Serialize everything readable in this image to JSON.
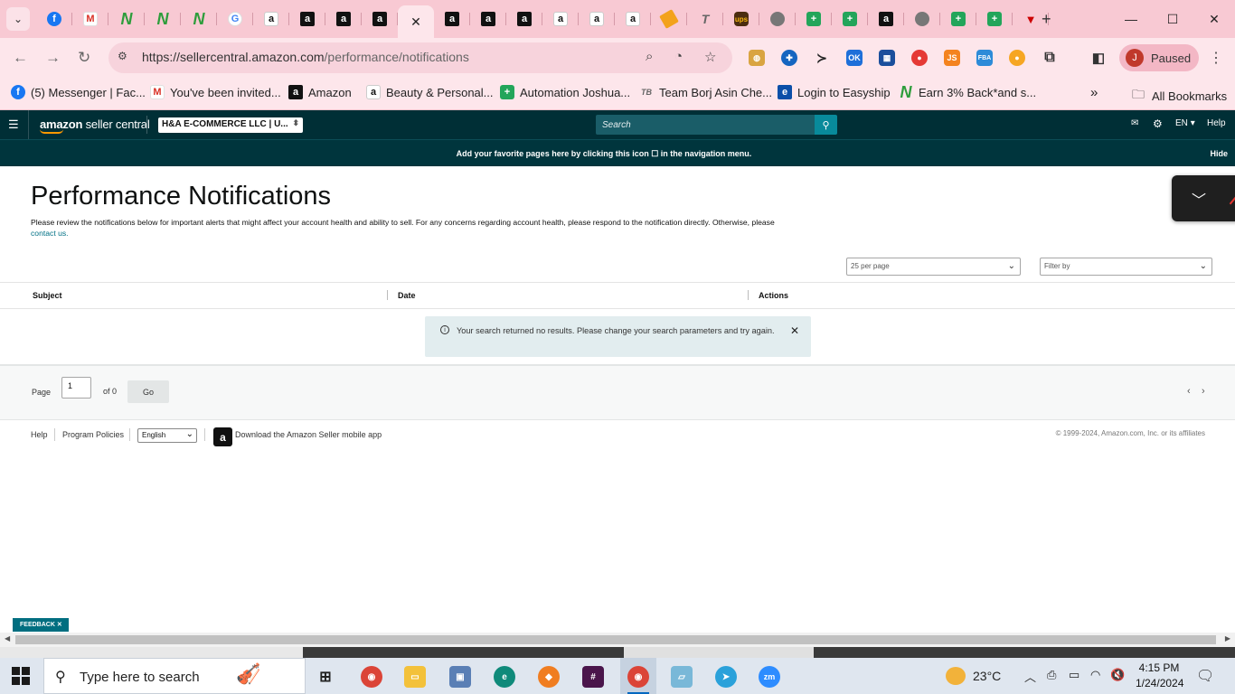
{
  "browser": {
    "tabs": [
      {
        "icon": "facebook-icon",
        "kind": "fb",
        "glyph": "f"
      },
      {
        "icon": "gmail-icon",
        "kind": "gm",
        "glyph": "M"
      },
      {
        "icon": "n-logo-icon",
        "kind": "n",
        "glyph": "N"
      },
      {
        "icon": "n-logo-icon",
        "kind": "n",
        "glyph": "N"
      },
      {
        "icon": "n-logo-icon",
        "kind": "n",
        "glyph": "N"
      },
      {
        "icon": "google-icon",
        "kind": "g",
        "glyph": "G"
      },
      {
        "icon": "amazon-icon",
        "kind": "ay",
        "glyph": "a"
      },
      {
        "icon": "amazon-icon",
        "kind": "a",
        "glyph": "a"
      },
      {
        "icon": "amazon-icon",
        "kind": "a",
        "glyph": "a"
      },
      {
        "icon": "amazon-icon",
        "kind": "a",
        "glyph": "a"
      },
      {
        "icon": "close-icon",
        "kind": "active",
        "glyph": "✕"
      },
      {
        "icon": "amazon-icon",
        "kind": "a",
        "glyph": "a"
      },
      {
        "icon": "amazon-icon",
        "kind": "a",
        "glyph": "a"
      },
      {
        "icon": "amazon-icon",
        "kind": "a",
        "glyph": "a"
      },
      {
        "icon": "amazon-icon",
        "kind": "ay",
        "glyph": "a"
      },
      {
        "icon": "amazon-icon",
        "kind": "ay",
        "glyph": "a"
      },
      {
        "icon": "amazon-icon",
        "kind": "ay",
        "glyph": "a"
      },
      {
        "icon": "tool-icon",
        "kind": "tool",
        "glyph": ""
      },
      {
        "icon": "t-logo-icon",
        "kind": "t",
        "glyph": "T"
      },
      {
        "icon": "ups-icon",
        "kind": "ups",
        "glyph": "ups"
      },
      {
        "icon": "globe-icon",
        "kind": "globe",
        "glyph": ""
      },
      {
        "icon": "sheets-icon",
        "kind": "sheet",
        "glyph": "+"
      },
      {
        "icon": "sheets-icon",
        "kind": "sheet",
        "glyph": "+"
      },
      {
        "icon": "amazon-icon",
        "kind": "a",
        "glyph": "a"
      },
      {
        "icon": "globe-icon",
        "kind": "globe",
        "glyph": ""
      },
      {
        "icon": "sheets-icon",
        "kind": "sheet",
        "glyph": "+"
      },
      {
        "icon": "sheets-icon",
        "kind": "sheet",
        "glyph": "+"
      },
      {
        "icon": "pdf-icon",
        "kind": "pdf",
        "glyph": "▼"
      }
    ],
    "url_host": "https://sellercentral.amazon.com",
    "url_path": "/performance/notifications",
    "profile_initial": "J",
    "profile_status": "Paused",
    "bookmarks": [
      {
        "label": "(5) Messenger | Fac...",
        "icon": "facebook-icon"
      },
      {
        "label": "You've been invited...",
        "icon": "gmail-icon"
      },
      {
        "label": "Amazon",
        "icon": "amazon-icon"
      },
      {
        "label": "Beauty & Personal...",
        "icon": "amazon-icon"
      },
      {
        "label": "Automation Joshua...",
        "icon": "sheets-icon"
      },
      {
        "label": "Team Borj Asin Che...",
        "icon": "team-icon"
      },
      {
        "label": "Login to Easyship",
        "icon": "easyship-icon"
      },
      {
        "label": "Earn 3% Back*and s...",
        "icon": "n-logo-icon"
      }
    ],
    "all_bookmarks": "All Bookmarks"
  },
  "header": {
    "logo_bold": "amazon",
    "logo_rest": " seller central",
    "account": "H&A E-COMMERCE LLC | U...",
    "search_placeholder": "Search",
    "lang": "EN",
    "help": "Help"
  },
  "favbar": {
    "message": "Add your favorite pages here by clicking this icon ☐ in the navigation menu.",
    "hide": "Hide"
  },
  "main": {
    "title": "Performance Notifications",
    "description": "Please review the notifications below for important alerts that might affect your account health and ability to sell. For any concerns regarding account health, please respond to the notification directly. Otherwise, please",
    "contact_link": "contact us.",
    "per_page": "25 per page",
    "filter": "Filter by",
    "columns": [
      "Subject",
      "Date",
      "Actions"
    ],
    "alert": "Your search returned no results. Please change your search parameters and try again.",
    "page_label": "Page",
    "page_value": "1",
    "of_label": "of 0",
    "go_label": "Go"
  },
  "footer": {
    "help": "Help",
    "policies": "Program Policies",
    "language": "English",
    "app": "Download the Amazon Seller mobile app",
    "copyright": "© 1999-2024, Amazon.com, Inc. or its affiliates",
    "feedback": "FEEDBACK"
  },
  "taskbar": {
    "search_placeholder": "Type here to search",
    "temperature": "23°C",
    "time": "4:15 PM",
    "date": "1/24/2024"
  },
  "colors": {
    "header_bg": "#002f36",
    "accent": "#088a9b",
    "tabstrip": "#f8c9d3",
    "link": "#007185"
  }
}
